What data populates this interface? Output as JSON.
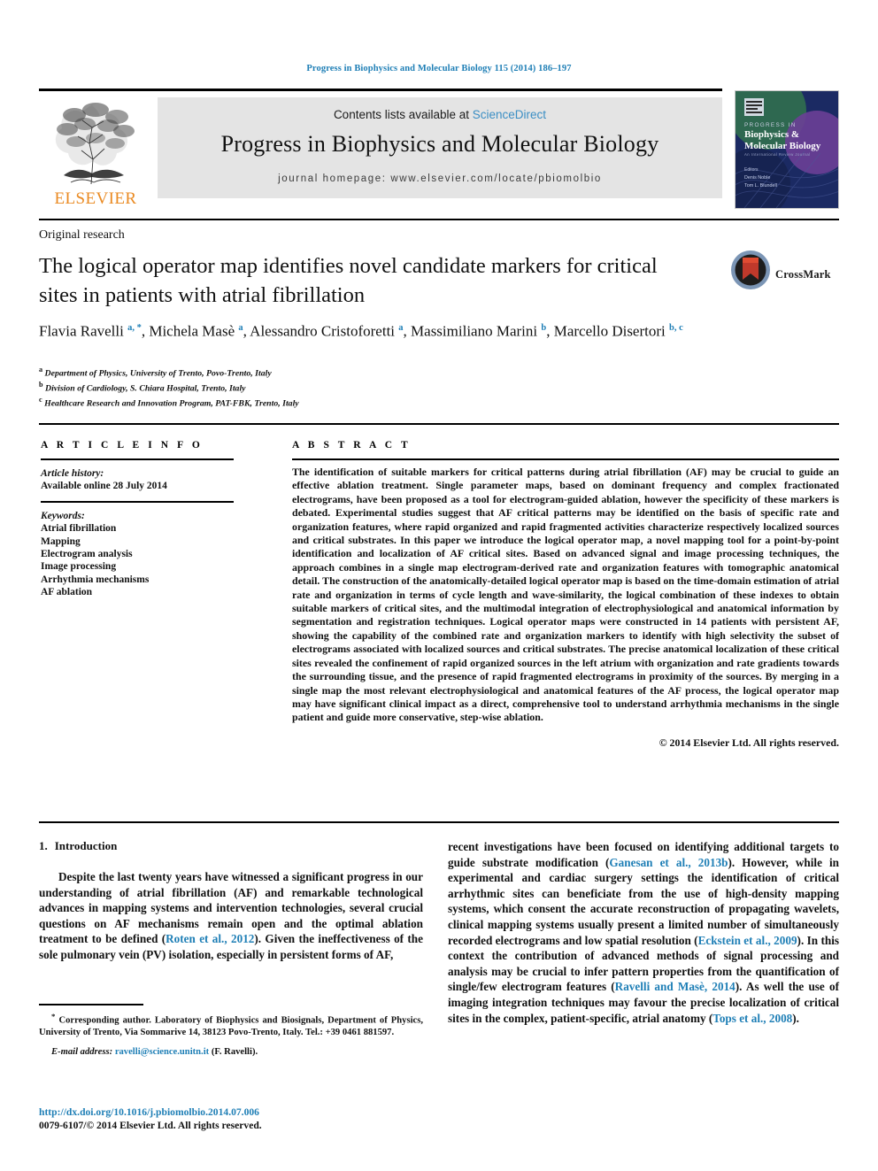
{
  "running_head": "Progress in Biophysics and Molecular Biology 115 (2014) 186–197",
  "masthead": {
    "contents_prefix": "Contents lists available at ",
    "sciencedirect": "ScienceDirect",
    "journal_title": "Progress in Biophysics and Molecular Biology",
    "homepage": "journal homepage: www.elsevier.com/locate/pbiomolbio",
    "publisher": "ELSEVIER",
    "publisher_color": "#ea8a22",
    "cover": {
      "line1": "P R O G R E S S   I N",
      "line2": "Biophysics &",
      "line3": "Molecular Biology",
      "line4": "An International Review Journal",
      "editors_label": "Editors",
      "editor1": "Denis Noble",
      "editor2": "Tom L. Blundell"
    }
  },
  "article": {
    "kicker": "Original research",
    "title": "The logical operator map identifies novel candidate markers for critical sites in patients with atrial fibrillation",
    "crossmark_label": "CrossMark",
    "authors_html": "Flavia Ravelli <sup>a, *</sup>, Michela Masè <sup>a</sup>, Alessandro Cristoforetti <sup>a</sup>, Massimiliano Marini <sup>b</sup>, Marcello Disertori <sup>b, c</sup>",
    "affiliations": [
      {
        "mark": "a",
        "text": "Department of Physics, University of Trento, Povo-Trento, Italy"
      },
      {
        "mark": "b",
        "text": "Division of Cardiology, S. Chiara Hospital, Trento, Italy"
      },
      {
        "mark": "c",
        "text": "Healthcare Research and Innovation Program, PAT-FBK, Trento, Italy"
      }
    ]
  },
  "article_info": {
    "heading": "A R T I C L E   I N F O",
    "history_label": "Article history:",
    "history_value": "Available online 28 July 2014",
    "keywords_label": "Keywords:",
    "keywords": [
      "Atrial fibrillation",
      "Mapping",
      "Electrogram analysis",
      "Image processing",
      "Arrhythmia mechanisms",
      "AF ablation"
    ]
  },
  "abstract": {
    "heading": "A B S T R A C T",
    "text": "The identification of suitable markers for critical patterns during atrial fibrillation (AF) may be crucial to guide an effective ablation treatment. Single parameter maps, based on dominant frequency and complex fractionated electrograms, have been proposed as a tool for electrogram-guided ablation, however the specificity of these markers is debated. Experimental studies suggest that AF critical patterns may be identified on the basis of specific rate and organization features, where rapid organized and rapid fragmented activities characterize respectively localized sources and critical substrates. In this paper we introduce the logical operator map, a novel mapping tool for a point-by-point identification and localization of AF critical sites. Based on advanced signal and image processing techniques, the approach combines in a single map electrogram-derived rate and organization features with tomographic anatomical detail. The construction of the anatomically-detailed logical operator map is based on the time-domain estimation of atrial rate and organization in terms of cycle length and wave-similarity, the logical combination of these indexes to obtain suitable markers of critical sites, and the multimodal integration of electrophysiological and anatomical information by segmentation and registration techniques. Logical operator maps were constructed in 14 patients with persistent AF, showing the capability of the combined rate and organization markers to identify with high selectivity the subset of electrograms associated with localized sources and critical substrates. The precise anatomical localization of these critical sites revealed the confinement of rapid organized sources in the left atrium with organization and rate gradients towards the surrounding tissue, and the presence of rapid fragmented electrograms in proximity of the sources. By merging in a single map the most relevant electrophysiological and anatomical features of the AF process, the logical operator map may have significant clinical impact as a direct, comprehensive tool to understand arrhythmia mechanisms in the single patient and guide more conservative, step-wise ablation.",
    "copyright": "© 2014 Elsevier Ltd. All rights reserved."
  },
  "introduction": {
    "number": "1.",
    "heading": "Introduction",
    "left_paragraph_html": "Despite the last twenty years have witnessed a significant progress in our understanding of atrial fibrillation (AF) and remarkable technological advances in mapping systems and intervention technologies, several crucial questions on AF mechanisms remain open and the optimal ablation treatment to be defined (<span class=\"lnk\">Roten et al., 2012</span>). Given the ineffectiveness of the sole pulmonary vein (PV) isolation, especially in persistent forms of AF,",
    "right_paragraph_html": "recent investigations have been focused on identifying additional targets to guide substrate modification (<span class=\"lnk\">Ganesan et al., 2013b</span>). However, while in experimental and cardiac surgery settings the identification of critical arrhythmic sites can beneficiate from the use of high-density mapping systems, which consent the accurate reconstruction of propagating wavelets, clinical mapping systems usually present a limited number of simultaneously recorded electrograms and low spatial resolution (<span class=\"lnk\">Eckstein et al., 2009</span>). In this context the contribution of advanced methods of signal processing and analysis may be crucial to infer pattern properties from the quantification of single/few electrogram features (<span class=\"lnk\">Ravelli and Masè, 2014</span>). As well the use of imaging integration techniques may favour the precise localization of critical sites in the complex, patient-specific, atrial anatomy (<span class=\"lnk\">Tops et al., 2008</span>)."
  },
  "footnotes": {
    "corresponding_html": "<sup>*</sup> Corresponding author. Laboratory of Biophysics and Biosignals, Department of Physics, University of Trento, Via Sommarive 14, 38123 Povo-Trento, Italy. Tel.: +39 0461 881597.",
    "email_label": "E-mail address:",
    "email": "ravelli@science.unitn.it",
    "email_owner": "(F. Ravelli).",
    "doi": "http://dx.doi.org/10.1016/j.pbiomolbio.2014.07.006",
    "issn_line": "0079-6107/© 2014 Elsevier Ltd. All rights reserved."
  }
}
